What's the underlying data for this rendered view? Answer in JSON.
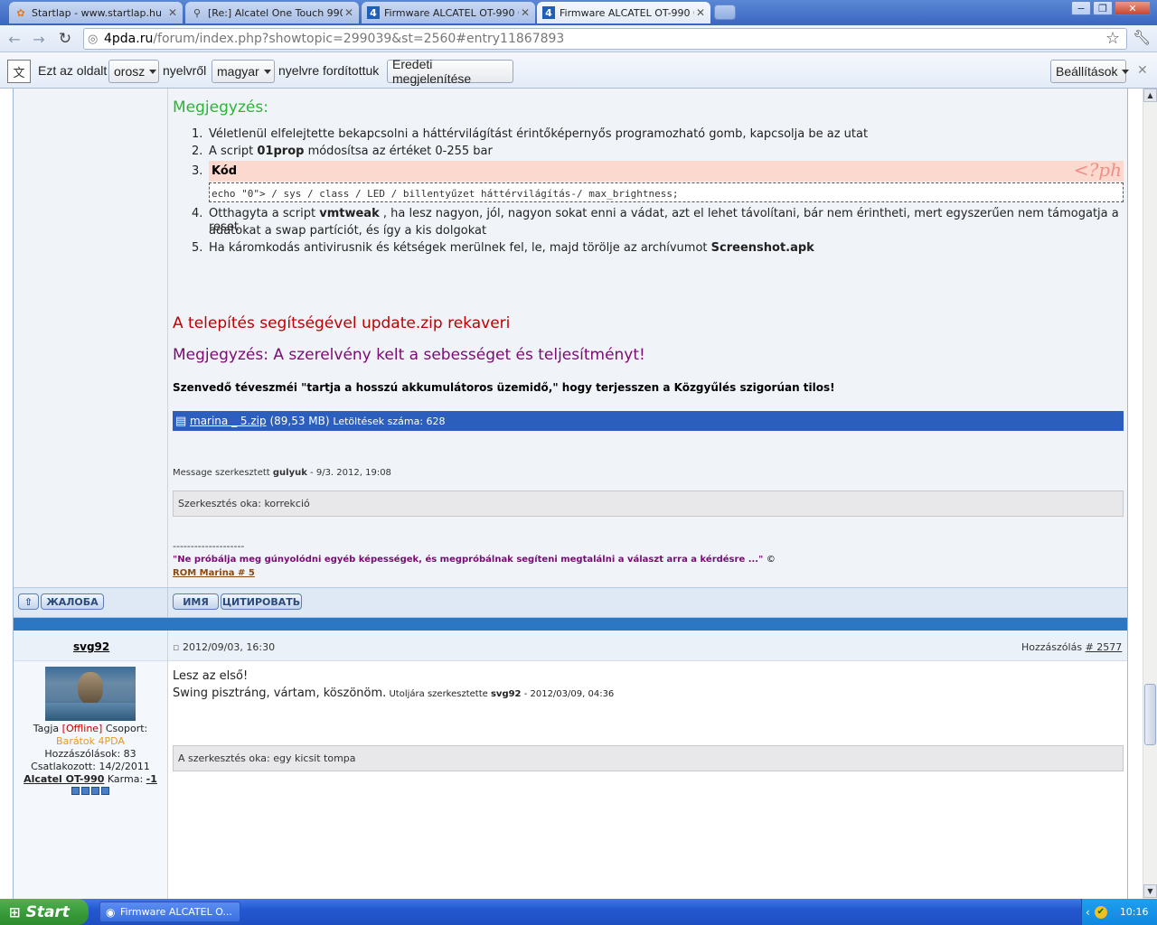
{
  "tabs": [
    {
      "title": "Startlap - www.startlap.hu",
      "icon": "startlap-icon"
    },
    {
      "title": "[Re:] Alcatel One Touch 990 -",
      "icon": "search-icon"
    },
    {
      "title": "Firmware ALCATEL OT-990 OS",
      "icon": "4pda-icon"
    },
    {
      "title": "Firmware ALCATEL OT-990 OS",
      "icon": "4pda-icon"
    }
  ],
  "window_buttons": {
    "minimize": "−",
    "restore": "❐",
    "close": "✕"
  },
  "address": {
    "host": "4pda.ru",
    "path": "/forum/index.php?showtopic=299039&st=2560#entry11867893"
  },
  "translate_bar": {
    "prefix": "Ezt az oldalt",
    "from_lang": "orosz",
    "from_suffix": "nyelvről",
    "to_lang": "magyar",
    "to_suffix": "nyelvre fordítottuk",
    "original_btn": "Eredeti megjelenítése",
    "settings_btn": "Beállítások"
  },
  "post1": {
    "note_heading": "Megjegyzés:",
    "items": [
      {
        "num": "1.",
        "text": "Véletlenül elfelejtette bekapcsolni a háttérvilágítást érintőképernyős programozható gomb, kapcsolja be az utat"
      },
      {
        "num": "2.",
        "pre": "A script ",
        "bold": "01prop",
        "post": " módosítsa az értéket 0-255 bar"
      },
      {
        "num": "3.",
        "code_label": "Kód",
        "code_watermark": "<?ph",
        "code": "echo \"0\"> / sys / class / LED / billentyűzet háttérvilágítás-/ max_brightness;"
      },
      {
        "num": "4.",
        "pre": "Otthagyta a script ",
        "bold": "vmtweak",
        "post": " , ha lesz nagyon, jól, nagyon sokat enni a vádat, azt el lehet távolítani, bár nem érintheti, mert egyszerűen nem támogatja a reset",
        "post2": "adatokat a swap partíciót, és így a kis dolgokat"
      },
      {
        "num": "5.",
        "pre": "Ha káromkodás antivirusnik és kétségek merülnek fel, le, majd törölje az archívumot ",
        "bold": "Screenshot.apk"
      }
    ],
    "install_heading": "A telepítés segítségével update.zip rekaveri",
    "note2": "Megjegyzés: A szerelvény kelt a sebességet és teljesítményt!",
    "bold_line": "Szenvedő téveszméi \"tartja a hosszú akkumulátoros üzemidő,\" hogy terjesszen a Közgyűlés szigorúan tilos!",
    "attachment": {
      "name": "marina _ 5.zip",
      "size": "(89,53 MB)",
      "downloads": "Letöltések száma: 628"
    },
    "edited": {
      "prefix": "Message szerkesztett ",
      "user": "gulyuk",
      "date": " - 9/3. 2012, 19:08"
    },
    "edit_reason": "Szerkesztés oka: korrekció",
    "sig_dashes": "--------------------",
    "sig_quote": "\"Ne próbálja meg gúnyolódni egyéb képességek, és megpróbálnak segíteni megtalálni a választ arra a kérdésre ...\"",
    "sig_copy": "©",
    "sig_link": "ROM Marina # 5"
  },
  "post_buttons": {
    "complain": "ЖАЛОБА",
    "name": "ИМЯ",
    "quote": "ЦИТИРОВАТЬ"
  },
  "post2": {
    "author": "svg92",
    "date": "2012/09/03, 16:30",
    "post_no_label": "Hozzászólás",
    "post_no": "# 2577",
    "line1": "Lesz az első!",
    "line2": "Swing pisztráng, vártam, köszönöm.",
    "edit_small_prefix": " Utoljára szerkesztette ",
    "edit_small_user": "svg92",
    "edit_small_date": " - 2012/03/09, 04:36",
    "edit_reason": "A szerkesztés oka: egy kicsit tompa",
    "profile": {
      "member": "Tagja",
      "status": "[Offline]",
      "group_label": "Csoport:",
      "group": "Barátok 4PDA",
      "posts": "Hozzászólások: 83",
      "joined": "Csatlakozott: 14/2/2011",
      "device": "Alcatel OT-990",
      "karma_label": " Karma: ",
      "karma": "-1"
    }
  },
  "taskbar": {
    "start": "Start",
    "item": "Firmware ALCATEL O...",
    "clock": "10:16"
  },
  "colors": {
    "accent": "#2b5ebd",
    "green": "#2db337",
    "red": "#c00000",
    "purple": "#7a0b73"
  }
}
